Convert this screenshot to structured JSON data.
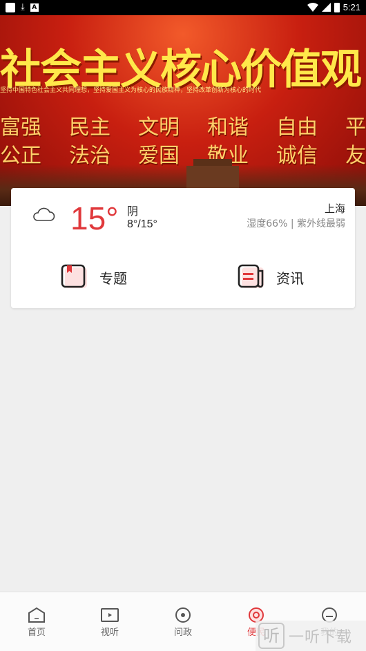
{
  "status_bar": {
    "time": "5:21"
  },
  "banner": {
    "title": "社会主义核心价值观",
    "subtitle": "坚持中国特色社会主义共同理想，坚持爱国主义为核心的民族精神，坚持改革创新为核心的时代",
    "values_row1": [
      "富强",
      "民主",
      "文明",
      "和谐",
      "自由",
      "平等"
    ],
    "values_row2": [
      "公正",
      "法治",
      "爱国",
      "敬业",
      "诚信",
      "友善"
    ]
  },
  "weather": {
    "temperature": "15°",
    "condition": "阴",
    "range": "8°/15°",
    "city": "上海",
    "detail": "湿度66% | 紫外线最弱",
    "icon": "cloud-icon"
  },
  "quick_links": {
    "topic_label": "专题",
    "news_label": "资讯"
  },
  "bottom_nav": {
    "items": [
      {
        "label": "首页",
        "icon": "home-icon"
      },
      {
        "label": "视听",
        "icon": "video-icon"
      },
      {
        "label": "问政",
        "icon": "inquiry-icon"
      },
      {
        "label": "便民",
        "icon": "service-icon"
      },
      {
        "label": "我的",
        "icon": "profile-icon"
      }
    ],
    "active": "便民"
  },
  "watermark": {
    "text": "一听下载"
  },
  "colors": {
    "accent": "#e0383b",
    "banner_red": "#c81f10",
    "banner_gold": "#ffe84a"
  }
}
